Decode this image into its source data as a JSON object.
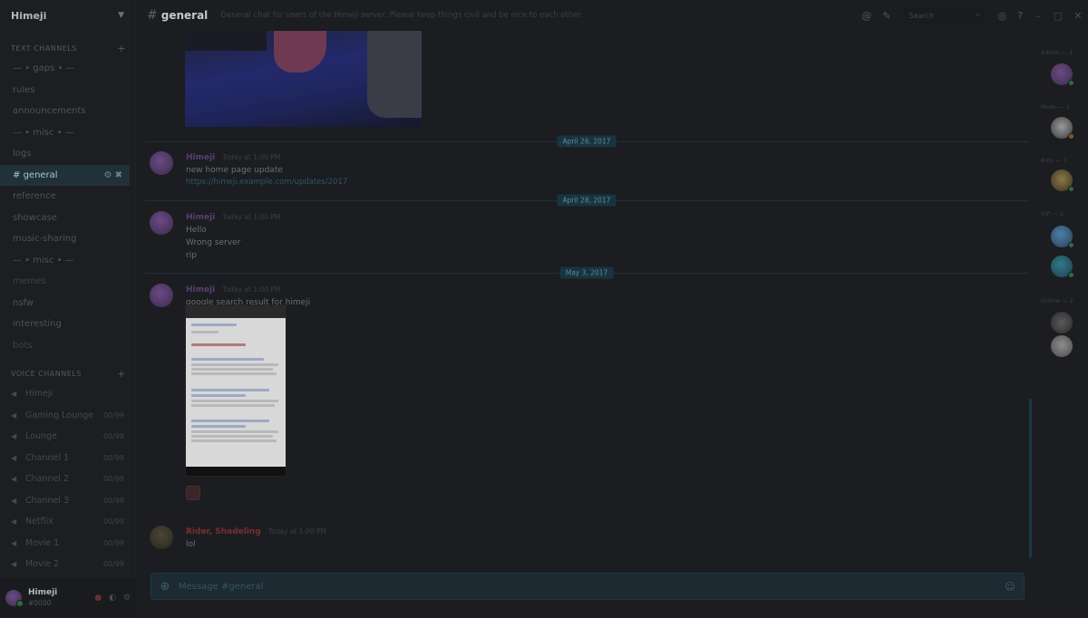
{
  "sidebar": {
    "server_name": "Himeji",
    "text_section": "TEXT CHANNELS",
    "channels": [
      {
        "label": "— • gaps • —",
        "state": "normal"
      },
      {
        "label": "rules",
        "state": "normal"
      },
      {
        "label": "announcements",
        "state": "normal"
      },
      {
        "label": "— • misc • —",
        "state": "normal"
      },
      {
        "label": "logs",
        "state": "normal"
      },
      {
        "label": "general",
        "state": "active"
      },
      {
        "label": "reference",
        "state": "normal"
      },
      {
        "label": "showcase",
        "state": "normal"
      },
      {
        "label": "music-sharing",
        "state": "normal"
      },
      {
        "label": "— • misc • —",
        "state": "normal"
      },
      {
        "label": "memes",
        "state": "dim"
      },
      {
        "label": "nsfw",
        "state": "normal"
      },
      {
        "label": "interesting",
        "state": "normal"
      },
      {
        "label": "bots",
        "state": "dim"
      }
    ],
    "active_channel_icons": "⚙ ✖",
    "voice_section": "VOICE CHANNELS",
    "voice_channels": [
      {
        "label": "Himeji",
        "count": ""
      },
      {
        "label": "Gaming Lounge",
        "count": "00/99"
      },
      {
        "label": "Lounge",
        "count": "00/99"
      },
      {
        "label": "Channel 1",
        "count": "00/99"
      },
      {
        "label": "Channel 2",
        "count": "00/99"
      },
      {
        "label": "Channel 3",
        "count": "00/99"
      },
      {
        "label": "Netflix",
        "count": "00/99"
      },
      {
        "label": "Movie 1",
        "count": "00/99"
      },
      {
        "label": "Movie 2",
        "count": "00/99"
      }
    ],
    "user": {
      "name": "Himeji",
      "tag": "#0000"
    }
  },
  "topbar": {
    "channel": "general",
    "topic": "General chat for users of the Himeji server. Please keep things civil and be nice to each other.",
    "search_placeholder": "Search"
  },
  "messages": {
    "dividers": [
      "April 26, 2017",
      "April 28, 2017",
      "May 3, 2017"
    ],
    "groups": [
      {
        "author": "Himeji",
        "time": "Today at 1:00 PM",
        "lines": [
          "new home page update"
        ],
        "link": "https://himeji.example.com/updates/2017"
      },
      {
        "author": "Himeji",
        "time": "Today at 1:00 PM",
        "lines": [
          "Hello",
          "Wrong server",
          "rip"
        ]
      },
      {
        "author": "Himeji",
        "time": "Today at 1:00 PM",
        "lines": [
          "google search result for himeji"
        ]
      },
      {
        "author": "Rider, Shadeling",
        "time": "Today at 1:00 PM",
        "lines": [
          "lol"
        ]
      }
    ]
  },
  "input": {
    "placeholder": "Message #general"
  },
  "members": {
    "roles": [
      "Admin — 1",
      "Mods — 1",
      "Bots — 1",
      "VIP — 2",
      "Online — 2"
    ],
    "colors": {
      "online": "#2a6b45",
      "idle": "#7a5a20"
    }
  }
}
